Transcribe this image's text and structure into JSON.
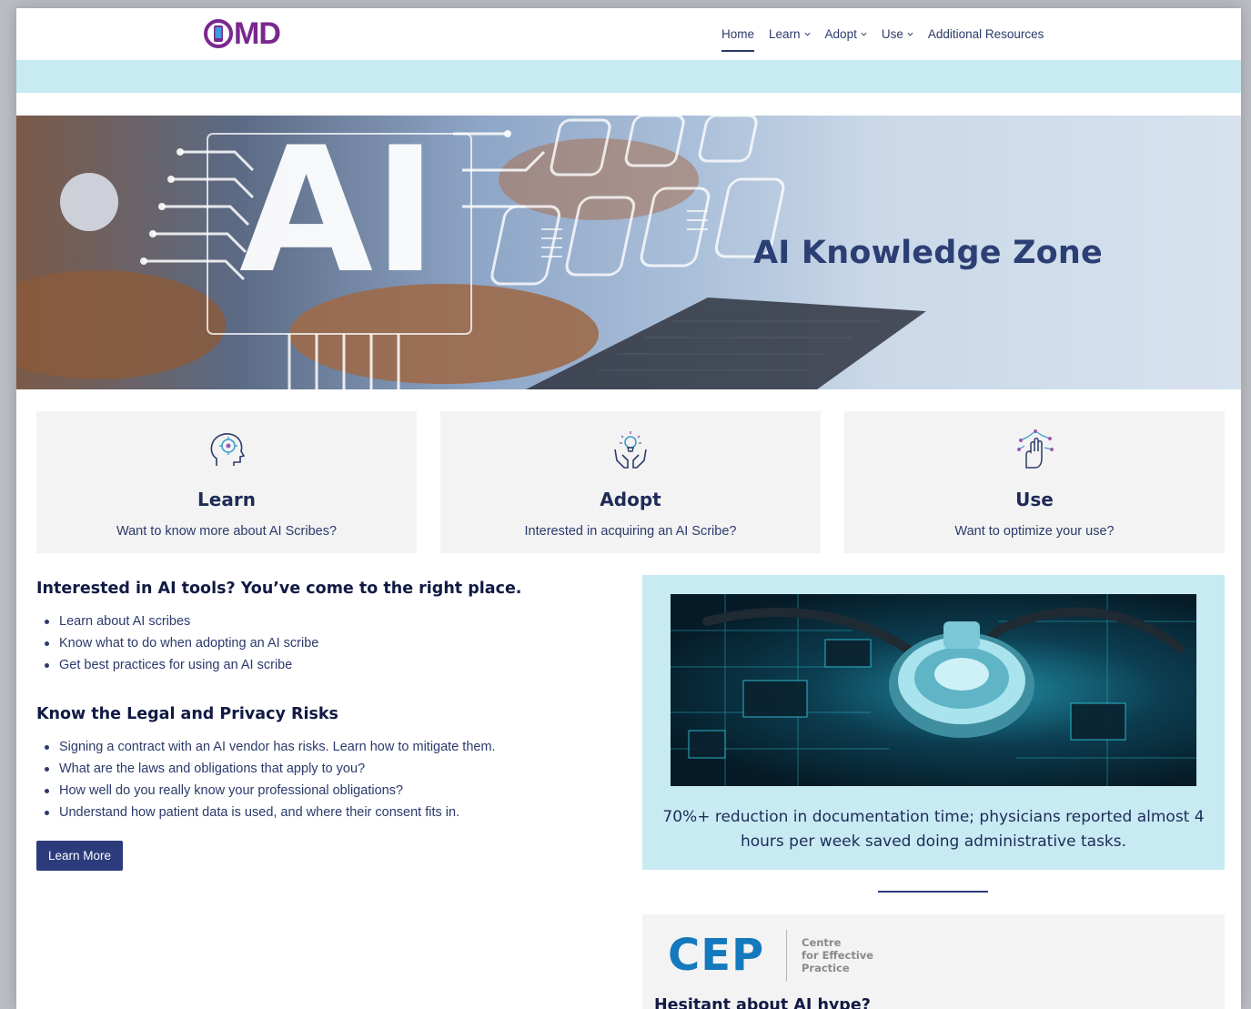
{
  "header": {
    "logo_text": "MD",
    "nav": [
      {
        "label": "Home",
        "active": true,
        "has_dropdown": false
      },
      {
        "label": "Learn",
        "active": false,
        "has_dropdown": true
      },
      {
        "label": "Adopt",
        "active": false,
        "has_dropdown": true
      },
      {
        "label": "Use",
        "active": false,
        "has_dropdown": true
      },
      {
        "label": "Additional Resources",
        "active": false,
        "has_dropdown": false
      }
    ]
  },
  "hero": {
    "title": "AI Knowledge Zone",
    "overlay_text": "AI"
  },
  "cards": [
    {
      "icon": "brain-head-icon",
      "title": "Learn",
      "subtitle": "Want to know more about AI Scribes?"
    },
    {
      "icon": "hands-lightbulb-icon",
      "title": "Adopt",
      "subtitle": "Interested in acquiring an AI Scribe?"
    },
    {
      "icon": "hand-network-icon",
      "title": "Use",
      "subtitle": "Want to optimize your use?"
    }
  ],
  "intro": {
    "heading": "Interested in AI tools? You’ve come to the right place.",
    "items": [
      "Learn about AI scribes",
      "Know what to do when adopting an AI scribe",
      "Get best practices for using an AI scribe"
    ]
  },
  "legal": {
    "heading": "Know the Legal and Privacy Risks",
    "items": [
      "Signing a contract with an AI vendor has risks. Learn how to mitigate them.",
      "What are the laws and obligations that apply to you?",
      "How well do you really know your professional obligations?",
      "Understand how patient data is used, and where their consent fits in."
    ],
    "button_label": "Learn More"
  },
  "stat": {
    "text": "70%+ reduction in documentation time; physicians reported almost 4 hours per week saved doing administrative tasks."
  },
  "cep": {
    "logo": "CEP",
    "sub_line1": "Centre",
    "sub_line2": "for Effective",
    "sub_line3": "Practice",
    "heading": "Hesitant about AI hype?"
  },
  "colors": {
    "brand_purple": "#7a2790",
    "navy": "#2b3b7c",
    "light_cyan": "#c7eaf3",
    "card_grey": "#f3f3f3",
    "cep_blue": "#1479bd"
  }
}
